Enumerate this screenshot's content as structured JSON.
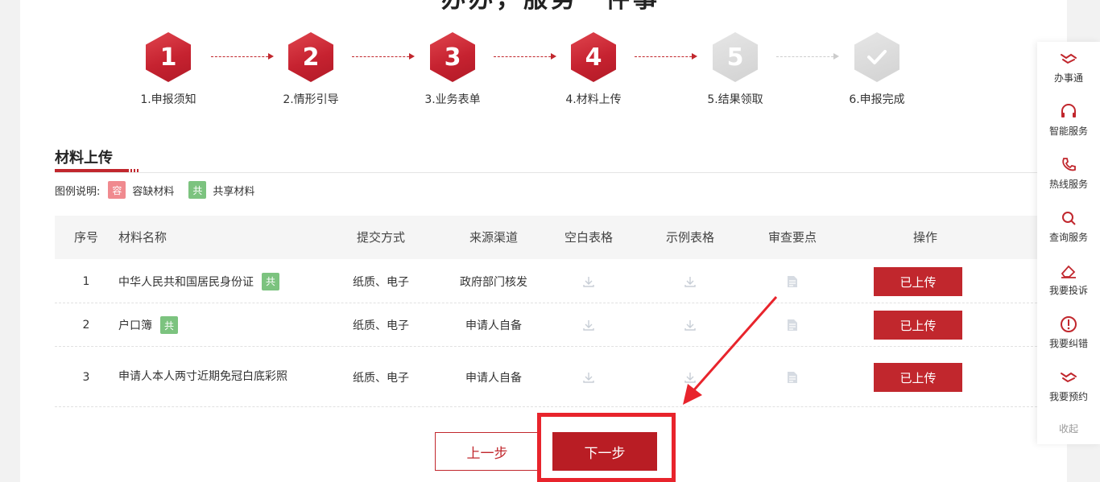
{
  "page": {
    "top_title": "办办，服务一件事"
  },
  "steps": [
    {
      "number": "1",
      "label": "1.申报须知",
      "state": "active"
    },
    {
      "number": "2",
      "label": "2.情形引导",
      "state": "active"
    },
    {
      "number": "3",
      "label": "3.业务表单",
      "state": "active"
    },
    {
      "number": "4",
      "label": "4.材料上传",
      "state": "active"
    },
    {
      "number": "5",
      "label": "5.结果领取",
      "state": "inactive"
    },
    {
      "number": "",
      "label": "6.申报完成",
      "state": "inactive"
    }
  ],
  "section": {
    "title": "材料上传",
    "legend_label": "图例说明:",
    "legend_items": [
      {
        "badge": "容",
        "text": "容缺材料"
      },
      {
        "badge": "共",
        "text": "共享材料"
      }
    ]
  },
  "table": {
    "headers": [
      "序号",
      "材料名称",
      "提交方式",
      "来源渠道",
      "空白表格",
      "示例表格",
      "审查要点",
      "操作"
    ],
    "rows": [
      {
        "index": "1",
        "name": "中华人民共和国居民身份证",
        "badge": "共",
        "method": "纸质、电子",
        "source": "政府部门核发",
        "action": "已上传"
      },
      {
        "index": "2",
        "name": "户口簿",
        "badge": "共",
        "method": "纸质、电子",
        "source": "申请人自备",
        "action": "已上传"
      },
      {
        "index": "3",
        "name": "申请人本人两寸近期免冠白底彩照",
        "badge": "",
        "method": "纸质、电子",
        "source": "申请人自备",
        "action": "已上传"
      }
    ]
  },
  "buttons": {
    "prev": "上一步",
    "next": "下一步"
  },
  "sidebar": {
    "items": [
      {
        "label": "办事通",
        "icon": "handshake-icon"
      },
      {
        "label": "智能服务",
        "icon": "headset-icon"
      },
      {
        "label": "热线服务",
        "icon": "phone-icon"
      },
      {
        "label": "查询服务",
        "icon": "search-icon"
      },
      {
        "label": "我要投诉",
        "icon": "eraser-icon"
      },
      {
        "label": "我要纠错",
        "icon": "alert-icon"
      },
      {
        "label": "我要预约",
        "icon": "handshake-icon"
      }
    ],
    "collapse": "收起"
  },
  "colors": {
    "accent": "#c1272d",
    "shared_badge": "#7cc37f",
    "lack_badge": "#f08a8f",
    "highlight": "#e8242c"
  }
}
